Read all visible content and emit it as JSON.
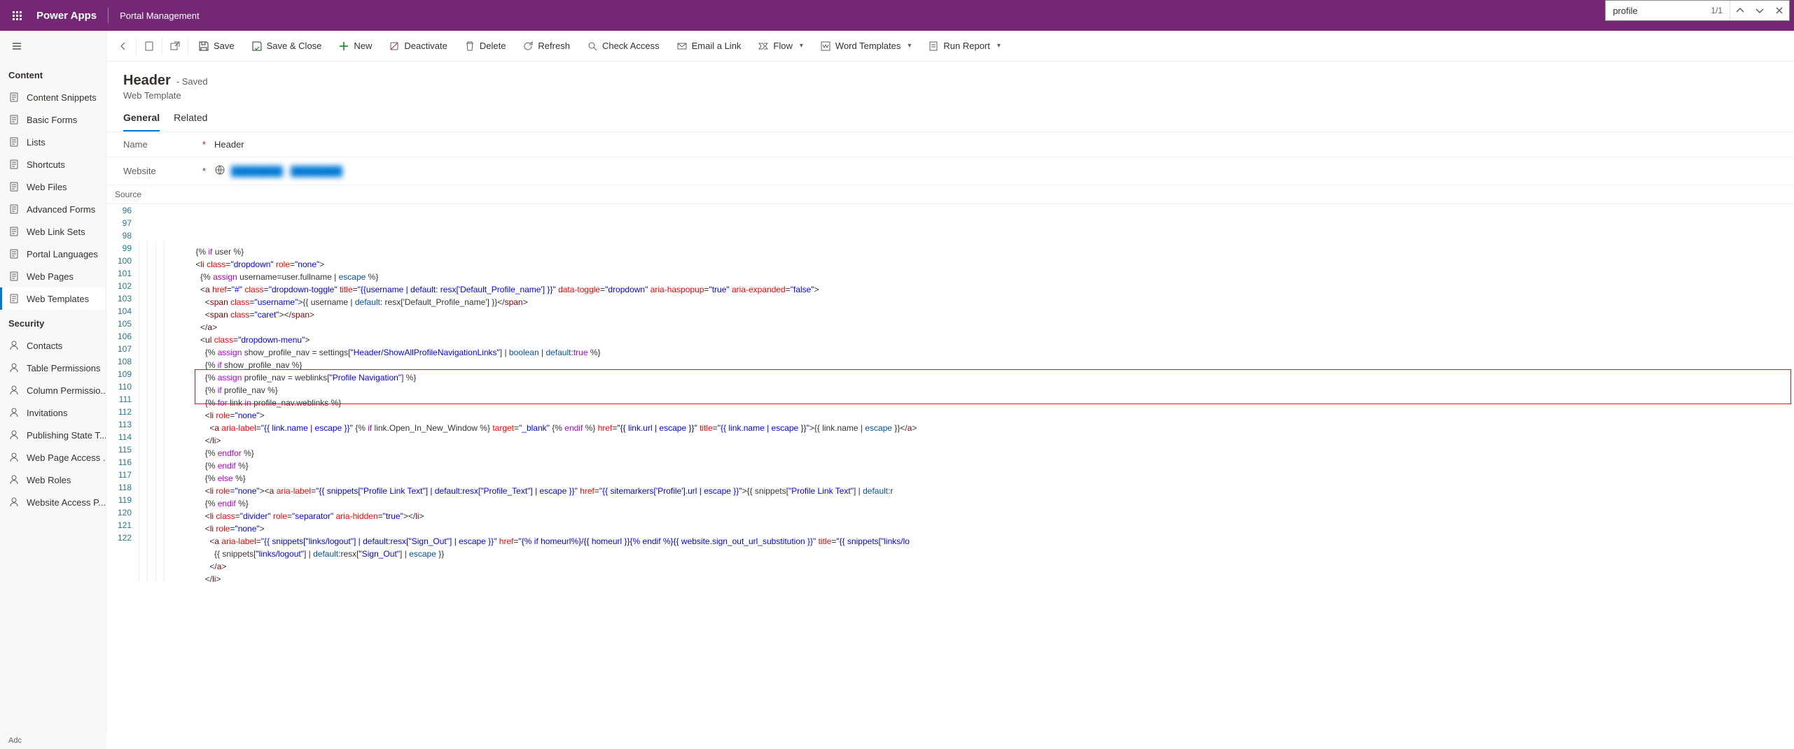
{
  "header": {
    "brand": "Power Apps",
    "appName": "Portal Management"
  },
  "search": {
    "value": "profile",
    "resultPos": "1/1"
  },
  "commands": {
    "save": "Save",
    "saveClose": "Save & Close",
    "new": "New",
    "deactivate": "Deactivate",
    "delete": "Delete",
    "refresh": "Refresh",
    "checkAccess": "Check Access",
    "emailLink": "Email a Link",
    "flow": "Flow",
    "wordTemplates": "Word Templates",
    "runReport": "Run Report"
  },
  "sidebar": {
    "sectionContent": "Content",
    "sectionSecurity": "Security",
    "contentItems": [
      {
        "label": "Content Snippets"
      },
      {
        "label": "Basic Forms"
      },
      {
        "label": "Lists"
      },
      {
        "label": "Shortcuts"
      },
      {
        "label": "Web Files"
      },
      {
        "label": "Advanced Forms"
      },
      {
        "label": "Web Link Sets"
      },
      {
        "label": "Portal Languages"
      },
      {
        "label": "Web Pages"
      },
      {
        "label": "Web Templates"
      }
    ],
    "securityItems": [
      {
        "label": "Contacts"
      },
      {
        "label": "Table Permissions"
      },
      {
        "label": "Column Permissio..."
      },
      {
        "label": "Invitations"
      },
      {
        "label": "Publishing State T..."
      },
      {
        "label": "Web Page Access ..."
      },
      {
        "label": "Web Roles"
      },
      {
        "label": "Website Access P..."
      }
    ],
    "bottom": "Adc"
  },
  "record": {
    "title": "Header",
    "status": "- Saved",
    "subtitle": "Web Template",
    "tabs": {
      "general": "General",
      "related": "Related"
    },
    "fields": {
      "nameLabel": "Name",
      "nameValue": "Header",
      "websiteLabel": "Website",
      "websiteValue": "████████ · ████████"
    },
    "sourceLabel": "Source"
  },
  "code": {
    "startLine": 96,
    "lines": [
      {
        "indent": 5,
        "html": "{% <span class='kw'>if</span> user %}"
      },
      {
        "indent": 5,
        "html": "&lt;<span class='tag'>li</span> <span class='attr'>class</span>=<span class='str'>\"dropdown\"</span> <span class='attr'>role</span>=<span class='str'>\"none\"</span>&gt;"
      },
      {
        "indent": 6,
        "html": "{% <span class='kw'>assign</span> username=user.fullname | <span class='filt'>escape</span> %}"
      },
      {
        "indent": 6,
        "html": "&lt;<span class='tag'>a</span> <span class='attr'>href</span>=<span class='str'>\"#\"</span> <span class='attr'>class</span>=<span class='str'>\"dropdown-toggle\"</span> <span class='attr'>title</span>=<span class='str'>\"{{username | default: resx['Default_Profile_name'] }}\"</span> <span class='attr'>data-toggle</span>=<span class='str'>\"dropdown\"</span> <span class='attr'>aria-haspopup</span>=<span class='str'>\"true\"</span> <span class='attr'>aria-expanded</span>=<span class='str'>\"false\"</span>&gt;"
      },
      {
        "indent": 7,
        "html": "&lt;<span class='tag'>span</span> <span class='attr'>class</span>=<span class='str'>\"username\"</span>&gt;{{ username | <span class='filt'>default</span>: resx['Default_Profile_name'] }}&lt;/<span class='tag'>span</span>&gt;"
      },
      {
        "indent": 7,
        "html": "&lt;<span class='tag'>span</span> <span class='attr'>class</span>=<span class='str'>\"caret\"</span>&gt;&lt;/<span class='tag'>span</span>&gt;"
      },
      {
        "indent": 6,
        "html": "&lt;/<span class='tag'>a</span>&gt;"
      },
      {
        "indent": 6,
        "html": "&lt;<span class='tag'>ul</span> <span class='attr'>class</span>=<span class='str'>\"dropdown-menu\"</span>&gt;"
      },
      {
        "indent": 7,
        "html": "{% <span class='kw'>assign</span> show_profile_nav = settings[<span class='str'>\"Header/ShowAllProfileNavigationLinks\"</span>] | <span class='filt'>boolean</span> | <span class='filt'>default</span>:<span class='kw'>true</span> %}"
      },
      {
        "indent": 7,
        "html": "{% <span class='kw'>if</span> show_profile_nav %}"
      },
      {
        "indent": 7,
        "html": "{% <span class='kw'>assign</span> profile_nav = weblinks[<span class='str'>\"Profile Navigation\"</span>] %}"
      },
      {
        "indent": 7,
        "html": "{% <span class='kw'>if</span> profile_nav %}"
      },
      {
        "indent": 7,
        "html": "{% <span class='kw'>for</span> link <span class='kw'>in</span> profile_nav.weblinks %}"
      },
      {
        "indent": 7,
        "html": "&lt;<span class='tag'>li</span> <span class='attr'>role</span>=<span class='str'>\"none\"</span>&gt;"
      },
      {
        "indent": 8,
        "html": "&lt;<span class='tag'>a</span> <span class='attr'>aria-label</span>=<span class='str'>\"{{ link.name | escape }}\"</span> {% <span class='kw'>if</span> link.Open_In_New_Window %} <span class='attr'>target</span>=<span class='str'>\"_blank\"</span> {% <span class='kw'>endif</span> %} <span class='attr'>href</span>=<span class='str'>\"{{ link.url | escape }}\"</span> <span class='attr'>title</span>=<span class='str'>\"{{ link.name | escape }}\"</span>&gt;{{ link.name | <span class='filt'>escape</span> }}&lt;/<span class='tag'>a</span>&gt;"
      },
      {
        "indent": 7,
        "html": "&lt;/<span class='tag'>li</span>&gt;"
      },
      {
        "indent": 7,
        "html": "{% <span class='kw'>endfor</span> %}"
      },
      {
        "indent": 7,
        "html": "{% <span class='kw'>endif</span> %}"
      },
      {
        "indent": 7,
        "html": "{% <span class='kw'>else</span> %}"
      },
      {
        "indent": 7,
        "html": "&lt;<span class='tag'>li</span> <span class='attr'>role</span>=<span class='str'>\"none\"</span>&gt;&lt;<span class='tag'>a</span> <span class='attr'>aria-label</span>=<span class='str'>\"{{ snippets[&quot;Profile Link Text&quot;] | default:resx[&quot;Profile_Text&quot;] | escape }}\"</span> <span class='attr'>href</span>=<span class='str'>\"{{ sitemarkers['Profile'].url | escape }}\"</span>&gt;{{ snippets[<span class='str'>\"Profile Link Text\"</span>] | <span class='filt'>default</span>:r"
      },
      {
        "indent": 7,
        "html": "{% <span class='kw'>endif</span> %}"
      },
      {
        "indent": 7,
        "html": "&lt;<span class='tag'>li</span> <span class='attr'>class</span>=<span class='str'>\"divider\"</span> <span class='attr'>role</span>=<span class='str'>\"separator\"</span> <span class='attr'>aria-hidden</span>=<span class='str'>\"true\"</span>&gt;&lt;/<span class='tag'>li</span>&gt;"
      },
      {
        "indent": 7,
        "html": "&lt;<span class='tag'>li</span> <span class='attr'>role</span>=<span class='str'>\"none\"</span>&gt;"
      },
      {
        "indent": 8,
        "html": "&lt;<span class='tag'>a</span> <span class='attr'>aria-label</span>=<span class='str'>\"{{ snippets[&quot;links/logout&quot;] | default:resx[&quot;Sign_Out&quot;] | escape }}\"</span> <span class='attr'>href</span>=<span class='str'>\"{% if homeurl%}/{{ homeurl }}{% endif %}{{ website.sign_out_url_substitution }}\"</span> <span class='attr'>title</span>=<span class='str'>\"{{ snippets[&quot;links/lo"
      },
      {
        "indent": 9,
        "html": "{{ snippets[<span class='str'>\"links/logout\"</span>] | <span class='filt'>default</span>:resx[<span class='str'>\"Sign_Out\"</span>] | <span class='filt'>escape</span> }}"
      },
      {
        "indent": 8,
        "html": "&lt;/<span class='tag'>a</span>&gt;"
      },
      {
        "indent": 7,
        "html": "&lt;/<span class='tag'>li</span>&gt;"
      }
    ]
  }
}
